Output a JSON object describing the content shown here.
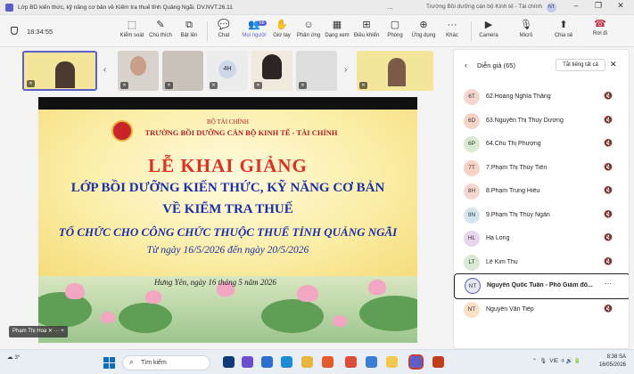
{
  "window": {
    "title": "Lớp BD kiến thức, kỹ năng cơ bản về Kiểm tra thuế tỉnh Quảng Ngãi. DV.NVT.26.11",
    "more_dots": "...",
    "org_title": "Trường Bồi dưỡng cán bộ Kinh tế - Tài chính",
    "avatar_initials": "NT",
    "controls": [
      "–",
      "❐",
      "✕"
    ]
  },
  "meeting": {
    "timer": "18:34:55",
    "toolbar": [
      {
        "label": "Kiểm soát",
        "icon": "⬚"
      },
      {
        "label": "Chú thích",
        "icon": "✎"
      },
      {
        "label": "Bật lên",
        "icon": "⧉"
      },
      {
        "label": "Chat",
        "icon": "💬"
      },
      {
        "label": "Mọi người",
        "icon": "👥",
        "badge": "66"
      },
      {
        "label": "Giơ tay",
        "icon": "✋"
      },
      {
        "label": "Phản ứng",
        "icon": "☺"
      },
      {
        "label": "Dạng xem",
        "icon": "▦"
      },
      {
        "label": "Điều khiển",
        "icon": "⊞"
      },
      {
        "label": "Phòng",
        "icon": "▢"
      },
      {
        "label": "Ứng dụng",
        "icon": "⊕"
      },
      {
        "label": "Khác",
        "icon": "···"
      },
      {
        "label": "Camera",
        "icon": "▶"
      },
      {
        "label": "Micrô",
        "icon": "🎙"
      },
      {
        "label": "Chia sẻ",
        "icon": "⬆"
      }
    ],
    "leave_label": "Rời đi",
    "leave_icon": "☎",
    "thumb_initials": "4H",
    "presenter_tag": "Phạm Thị Hoa"
  },
  "slide": {
    "ministry": "BỘ TÀI CHÍNH",
    "school": "TRƯỜNG BỒI DƯỠNG CÁN BỘ KINH TẾ - TÀI CHÍNH",
    "headline": "LỄ KHAI GIẢNG",
    "course_line1": "LỚP BỒI DƯỠNG KIẾN THỨC, KỸ NĂNG CƠ BẢN",
    "course_line2": "VỀ KIỂM TRA THUẾ",
    "audience": "TỔ CHỨC CHO CÔNG CHỨC THUỘC THUẾ TỈNH QUẢNG NGÃI",
    "dates": "Từ ngày 16/5/2026 đến ngày 20/5/2026",
    "place_date": "Hưng Yên, ngày 16 tháng 5 năm 2026"
  },
  "panel": {
    "title": "Diễn giả (65)",
    "mute_all": "Tắt tiếng tất cả",
    "participants": [
      {
        "initials": "6T",
        "name": "62.Hoàng Nghĩa Thắng",
        "color": "#f6d7cf"
      },
      {
        "initials": "6D",
        "name": "63.Nguyễn Thị Thùy Dương",
        "color": "#f7d3c7"
      },
      {
        "initials": "6P",
        "name": "64.Chu Thị Phượng",
        "color": "#d9ead3"
      },
      {
        "initials": "7T",
        "name": "7.Phạm Thị Thủy Tiên",
        "color": "#f7d3c7"
      },
      {
        "initials": "8H",
        "name": "8.Phạm Trung Hiếu",
        "color": "#f6d7cf"
      },
      {
        "initials": "9N",
        "name": "9.Phạm Thị Thúy Ngân",
        "color": "#d3e6ee"
      },
      {
        "initials": "HL",
        "name": "Hạ Long",
        "color": "#e8d6ee"
      },
      {
        "initials": "LT",
        "name": "Lê Kim Thu",
        "color": "#d9ead3"
      },
      {
        "initials": "NT",
        "name": "Nguyễn Quốc Tuấn - Phó Giám đố...",
        "color": "#e6e6f5",
        "highlight": true
      },
      {
        "initials": "NT",
        "name": "Nguyễn Văn Tiếp",
        "color": "#fbe0c6"
      }
    ]
  },
  "taskbar": {
    "weather_temp": "3°",
    "search_placeholder": "Tìm kiếm",
    "lang": "VIE",
    "time": "8:38 SA",
    "date": "16/05/2026"
  }
}
